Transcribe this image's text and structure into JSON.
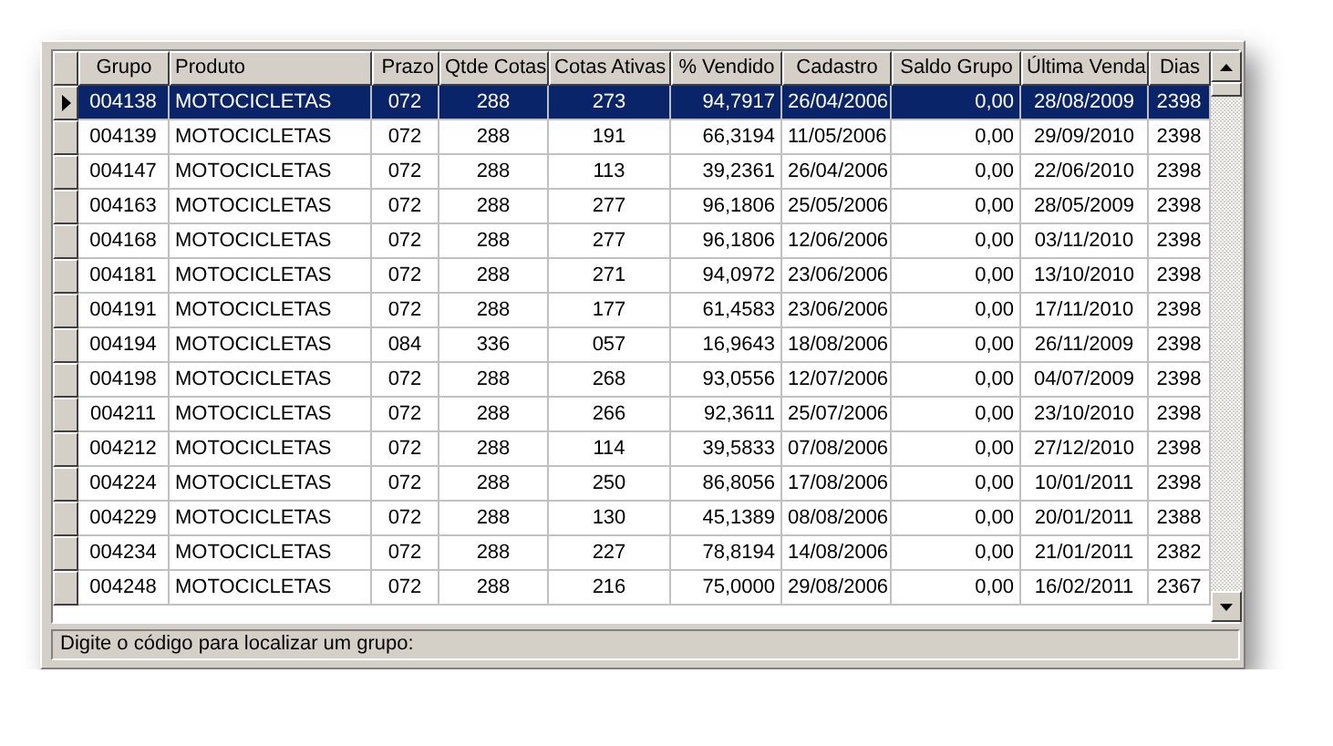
{
  "table": {
    "columns": [
      "Grupo",
      "Produto",
      "Prazo",
      "Qtde Cotas",
      "Cotas Ativas",
      "% Vendido",
      "Cadastro",
      "Saldo Grupo",
      "Última Venda",
      "Dias"
    ],
    "rows": [
      {
        "selected": true,
        "cells": [
          "004138",
          "MOTOCICLETAS",
          "072",
          "288",
          "273",
          "94,7917",
          "26/04/2006",
          "0,00",
          "28/08/2009",
          "2398"
        ]
      },
      {
        "selected": false,
        "cells": [
          "004139",
          "MOTOCICLETAS",
          "072",
          "288",
          "191",
          "66,3194",
          "11/05/2006",
          "0,00",
          "29/09/2010",
          "2398"
        ]
      },
      {
        "selected": false,
        "cells": [
          "004147",
          "MOTOCICLETAS",
          "072",
          "288",
          "113",
          "39,2361",
          "26/04/2006",
          "0,00",
          "22/06/2010",
          "2398"
        ]
      },
      {
        "selected": false,
        "cells": [
          "004163",
          "MOTOCICLETAS",
          "072",
          "288",
          "277",
          "96,1806",
          "25/05/2006",
          "0,00",
          "28/05/2009",
          "2398"
        ]
      },
      {
        "selected": false,
        "cells": [
          "004168",
          "MOTOCICLETAS",
          "072",
          "288",
          "277",
          "96,1806",
          "12/06/2006",
          "0,00",
          "03/11/2010",
          "2398"
        ]
      },
      {
        "selected": false,
        "cells": [
          "004181",
          "MOTOCICLETAS",
          "072",
          "288",
          "271",
          "94,0972",
          "23/06/2006",
          "0,00",
          "13/10/2010",
          "2398"
        ]
      },
      {
        "selected": false,
        "cells": [
          "004191",
          "MOTOCICLETAS",
          "072",
          "288",
          "177",
          "61,4583",
          "23/06/2006",
          "0,00",
          "17/11/2010",
          "2398"
        ]
      },
      {
        "selected": false,
        "cells": [
          "004194",
          "MOTOCICLETAS",
          "084",
          "336",
          "057",
          "16,9643",
          "18/08/2006",
          "0,00",
          "26/11/2009",
          "2398"
        ]
      },
      {
        "selected": false,
        "cells": [
          "004198",
          "MOTOCICLETAS",
          "072",
          "288",
          "268",
          "93,0556",
          "12/07/2006",
          "0,00",
          "04/07/2009",
          "2398"
        ]
      },
      {
        "selected": false,
        "cells": [
          "004211",
          "MOTOCICLETAS",
          "072",
          "288",
          "266",
          "92,3611",
          "25/07/2006",
          "0,00",
          "23/10/2010",
          "2398"
        ]
      },
      {
        "selected": false,
        "cells": [
          "004212",
          "MOTOCICLETAS",
          "072",
          "288",
          "114",
          "39,5833",
          "07/08/2006",
          "0,00",
          "27/12/2010",
          "2398"
        ]
      },
      {
        "selected": false,
        "cells": [
          "004224",
          "MOTOCICLETAS",
          "072",
          "288",
          "250",
          "86,8056",
          "17/08/2006",
          "0,00",
          "10/01/2011",
          "2398"
        ]
      },
      {
        "selected": false,
        "cells": [
          "004229",
          "MOTOCICLETAS",
          "072",
          "288",
          "130",
          "45,1389",
          "08/08/2006",
          "0,00",
          "20/01/2011",
          "2388"
        ]
      },
      {
        "selected": false,
        "cells": [
          "004234",
          "MOTOCICLETAS",
          "072",
          "288",
          "227",
          "78,8194",
          "14/08/2006",
          "0,00",
          "21/01/2011",
          "2382"
        ]
      },
      {
        "selected": false,
        "cells": [
          "004248",
          "MOTOCICLETAS",
          "072",
          "288",
          "216",
          "75,0000",
          "29/08/2006",
          "0,00",
          "16/02/2011",
          "2367"
        ]
      }
    ]
  },
  "status_bar": "Digite o código para localizar um grupo:"
}
